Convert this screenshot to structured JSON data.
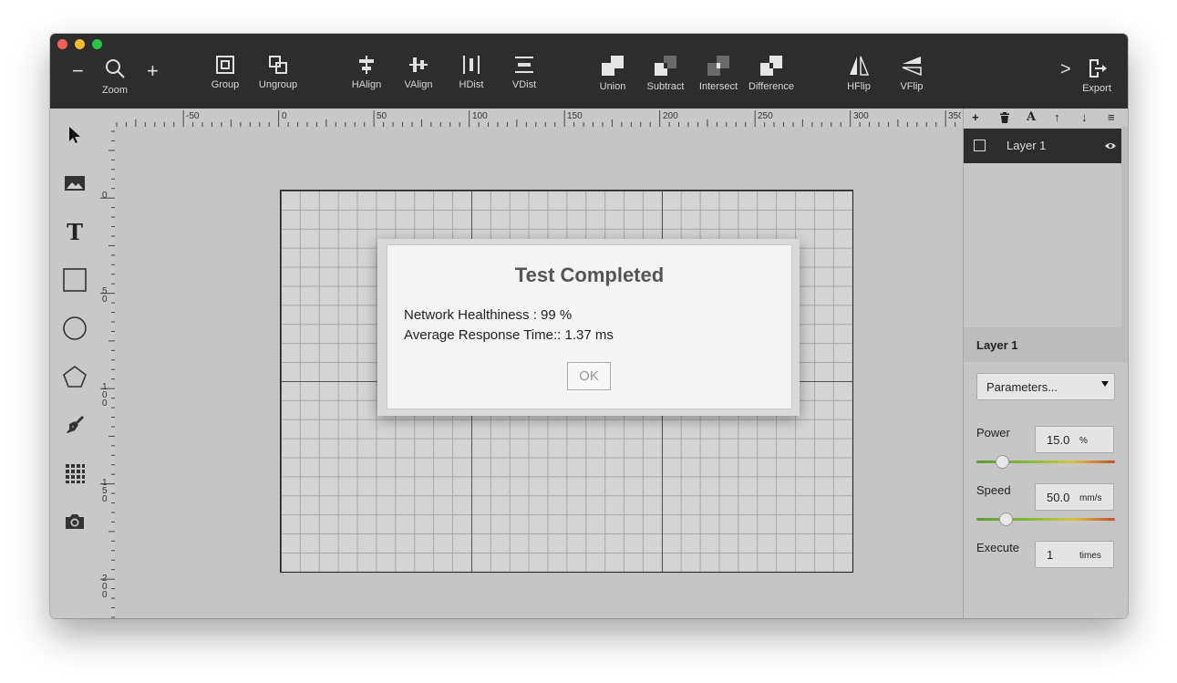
{
  "toolbar": {
    "zoom_minus": "−",
    "zoom_plus": "+",
    "zoom_label": "Zoom",
    "buttons": [
      {
        "label": "Group",
        "icon": "group-icon"
      },
      {
        "label": "Ungroup",
        "icon": "ungroup-icon"
      },
      {
        "label": "HAlign",
        "icon": "halign-icon"
      },
      {
        "label": "VAlign",
        "icon": "valign-icon"
      },
      {
        "label": "HDist",
        "icon": "hdist-icon"
      },
      {
        "label": "VDist",
        "icon": "vdist-icon"
      },
      {
        "label": "Union",
        "icon": "union-icon"
      },
      {
        "label": "Subtract",
        "icon": "subtract-icon"
      },
      {
        "label": "Intersect",
        "icon": "intersect-icon"
      },
      {
        "label": "Difference",
        "icon": "difference-icon"
      },
      {
        "label": "HFlip",
        "icon": "hflip-icon"
      },
      {
        "label": "VFlip",
        "icon": "vflip-icon"
      }
    ],
    "more": ">",
    "export_label": "Export"
  },
  "rulers": {
    "top": [
      "-50",
      "0",
      "50",
      "100",
      "150",
      "200",
      "250",
      "300",
      "350"
    ],
    "left": [
      "0",
      "5\n0",
      "1\n0\n0",
      "1\n5\n0",
      "2\n0\n0"
    ]
  },
  "layers": {
    "toolbar_icons": [
      "+",
      "trash-icon",
      "A",
      "↑",
      "↓",
      "≡"
    ],
    "items": [
      {
        "name": "Layer 1",
        "visible": true
      }
    ]
  },
  "properties": {
    "header": "Layer 1",
    "mode": "Parameters...",
    "power_label": "Power",
    "power_value": "15.0",
    "power_unit": "%",
    "power_level": 0.15,
    "speed_label": "Speed",
    "speed_value": "50.0",
    "speed_unit": "mm/s",
    "speed_level": 0.18,
    "execute_label": "Execute",
    "execute_value": "1",
    "execute_unit": "times"
  },
  "dialog": {
    "title": "Test Completed",
    "line1": "Network Healthiness : 99 %",
    "line2": "Average Response Time:: 1.37 ms",
    "ok": "OK"
  },
  "colors": {
    "toolbar_bg": "#2d2d2d",
    "close": "#fc5f57",
    "minimize": "#fdbc2e",
    "zoom": "#28c840"
  }
}
